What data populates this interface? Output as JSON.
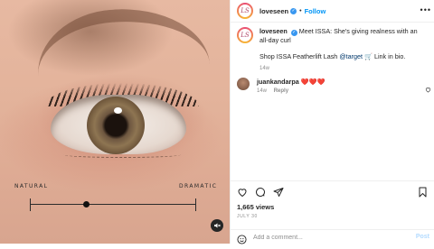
{
  "media": {
    "slider_left_label": "NATURAL",
    "slider_right_label": "DRAMATIC",
    "slider_position": 0.34,
    "mute_icon": "speaker-muted-icon"
  },
  "header": {
    "avatar_text": "LS",
    "username": "loveseen",
    "separator": "•",
    "follow_label": "Follow",
    "more_label": "•••"
  },
  "caption": {
    "username": "loveseen",
    "text": "Meet ISSA: She's giving realness with an all-day curl",
    "shop_prefix": "Shop ISSA Featherlift Lash ",
    "shop_link": "@target",
    "shop_emoji": "🛒",
    "shop_suffix": " Link in bio.",
    "time": "14w"
  },
  "comment": {
    "username": "juankandarpa",
    "text": "❤️❤️❤️",
    "time": "14w",
    "reply_label": "Reply"
  },
  "stats": {
    "views": "1,665 views",
    "date": "JULY 30"
  },
  "add_comment": {
    "placeholder": "Add a comment...",
    "post_label": "Post"
  },
  "colors": {
    "follow_blue": "#0095f6",
    "verified_blue": "#3897f0",
    "post_disabled": "#b3dbff",
    "muted_text": "#8e8e8e"
  }
}
